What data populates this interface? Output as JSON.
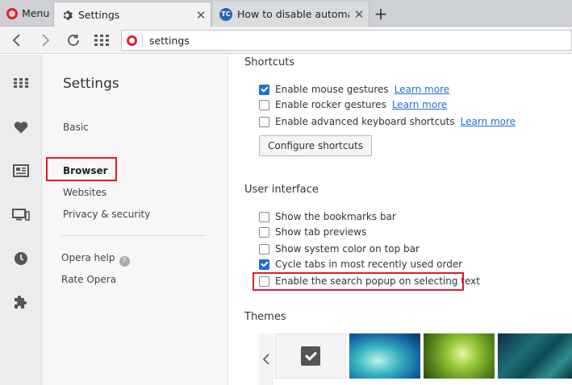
{
  "browser": {
    "menu_label": "Menu",
    "tabs": [
      {
        "label": "Settings",
        "active": true
      },
      {
        "label": "How to disable automatic",
        "active": false
      }
    ],
    "address": "settings",
    "colors": {
      "accent_red": "#e01b24",
      "link_blue": "#1e6fd9"
    }
  },
  "settings_nav": {
    "title": "Settings",
    "items": [
      {
        "label": "Basic"
      },
      {
        "label": "Browser",
        "active": true
      },
      {
        "label": "Websites"
      },
      {
        "label": "Privacy & security"
      }
    ],
    "help_label": "Opera help",
    "rate_label": "Rate Opera"
  },
  "shortcuts": {
    "title": "Shortcuts",
    "items": [
      {
        "label": "Enable mouse gestures",
        "checked": true,
        "link": "Learn more"
      },
      {
        "label": "Enable rocker gestures",
        "checked": false,
        "link": "Learn more"
      },
      {
        "label": "Enable advanced keyboard shortcuts",
        "checked": false,
        "link": "Learn more"
      }
    ],
    "configure_label": "Configure shortcuts"
  },
  "user_interface": {
    "title": "User interface",
    "items": [
      {
        "label": "Show the bookmarks bar",
        "checked": false
      },
      {
        "label": "Show tab previews",
        "checked": false
      },
      {
        "label": "Show system color on top bar",
        "checked": false
      },
      {
        "label": "Cycle tabs in most recently used order",
        "checked": true
      },
      {
        "label": "Enable the search popup on selecting text",
        "checked": false
      }
    ]
  },
  "themes": {
    "title": "Themes"
  }
}
